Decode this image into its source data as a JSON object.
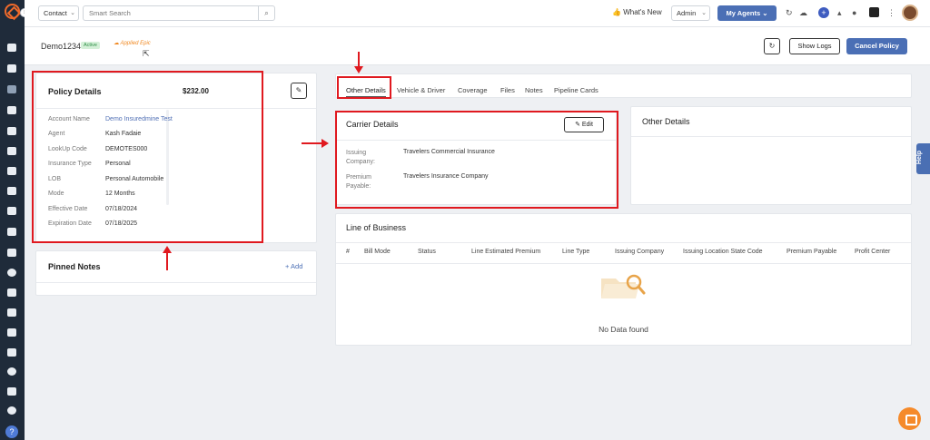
{
  "topbar": {
    "contact_select": "Contact",
    "search_placeholder": "Smart Search",
    "whats_new": "What's New",
    "admin_select": "Admin",
    "my_agents": "My Agents"
  },
  "subheader": {
    "policy_id": "Demo1234",
    "status_badge": "Active",
    "carrier_logo": "Applied Epic",
    "show_logs": "Show Logs",
    "cancel_policy": "Cancel Policy"
  },
  "policy_details": {
    "title": "Policy Details",
    "amount": "$232.00",
    "rows": [
      {
        "label": "Account Name",
        "value": "Demo Insuredmine Test"
      },
      {
        "label": "Agent",
        "value": "Kash Fadaie"
      },
      {
        "label": "LookUp Code",
        "value": "DEMOTES000"
      },
      {
        "label": "Insurance Type",
        "value": "Personal"
      },
      {
        "label": "LOB",
        "value": "Personal Automobile"
      },
      {
        "label": "Mode",
        "value": "12 Months"
      },
      {
        "label": "Effective Date",
        "value": "07/18/2024"
      },
      {
        "label": "Expiration Date",
        "value": "07/18/2025"
      }
    ]
  },
  "pinned_notes": {
    "title": "Pinned Notes",
    "add": "+ Add"
  },
  "tabs": [
    "Other Details",
    "Vehicle & Driver",
    "Coverage",
    "Files",
    "Notes",
    "Pipeline Cards"
  ],
  "carrier_details": {
    "title": "Carrier Details",
    "edit": "Edit",
    "rows": [
      {
        "label": "Issuing Company:",
        "value": "Travelers Commercial Insurance"
      },
      {
        "label": "Premium Payable:",
        "value": "Travelers Insurance Company"
      }
    ]
  },
  "other_details": {
    "title": "Other Details"
  },
  "line_of_business": {
    "title": "Line of Business",
    "columns": [
      "#",
      "Bill Mode",
      "Status",
      "Line Estimated Premium",
      "Line Type",
      "Issuing Company",
      "Issuing Location State Code",
      "Premium Payable",
      "Profit Center"
    ],
    "empty_text": "No Data found"
  },
  "help_tab": "Help",
  "colors": {
    "accent": "#4b6fb5",
    "annotation": "#e0191f",
    "sidebar": "#1f2b3a"
  }
}
